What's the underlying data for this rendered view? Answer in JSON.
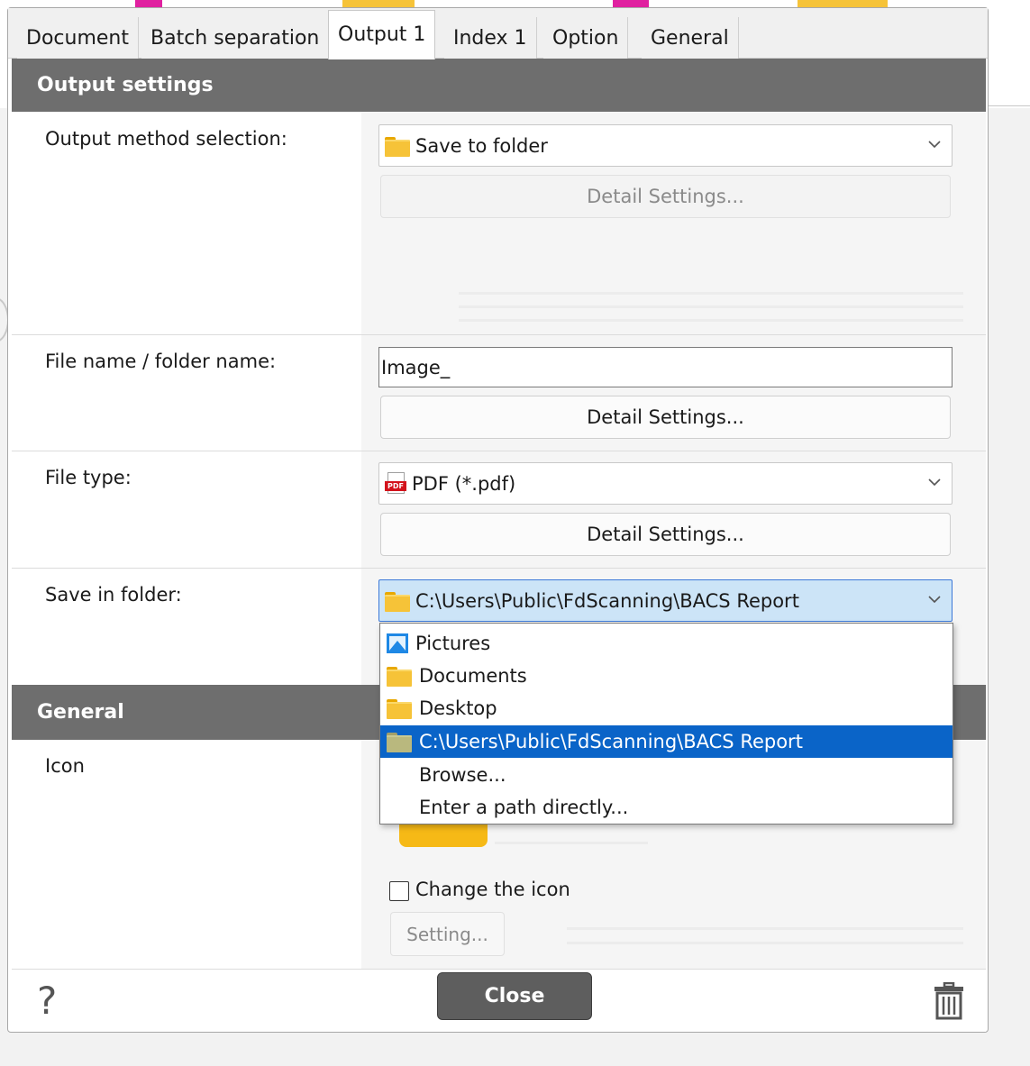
{
  "tabs": [
    "Document",
    "Batch separation",
    "Output 1",
    "Index 1",
    "Option",
    "General"
  ],
  "active_tab": "Output 1",
  "output_settings": {
    "header": "Output settings",
    "output_method": {
      "label": "Output method selection:",
      "value": "Save to folder",
      "icon": "folder-icon",
      "detail_label": "Detail Settings..."
    },
    "file_name": {
      "label": "File name / folder name:",
      "value": "Image_",
      "detail_label": "Detail Settings..."
    },
    "file_type": {
      "label": "File type:",
      "value": "PDF (*.pdf)",
      "icon": "pdf-icon",
      "pdf_tag": "PDF",
      "detail_label": "Detail Settings..."
    },
    "save_folder": {
      "label": "Save in folder:",
      "value": "C:\\Users\\Public\\FdScanning\\BACS Report",
      "options": [
        {
          "label": "Pictures",
          "icon": "pictures-icon"
        },
        {
          "label": "Documents",
          "icon": "folder-icon"
        },
        {
          "label": "Desktop",
          "icon": "folder-icon"
        },
        {
          "label": "C:\\Users\\Public\\FdScanning\\BACS Report",
          "icon": "folder-icon"
        },
        {
          "label": "Browse...",
          "icon": ""
        },
        {
          "label": "Enter a path directly...",
          "icon": ""
        }
      ],
      "selected_index": 3
    }
  },
  "general": {
    "header": "General",
    "icon_label": "Icon",
    "change_icon_label": "Change the icon",
    "change_icon_checked": false,
    "setting_label": "Setting..."
  },
  "footer": {
    "help": "?",
    "close_label": "Close"
  },
  "colors": {
    "header_bg": "#6e6e6e",
    "selected_bg": "#0a64c8",
    "focus_bg": "#cce4f7",
    "folder": "#f6c338"
  }
}
